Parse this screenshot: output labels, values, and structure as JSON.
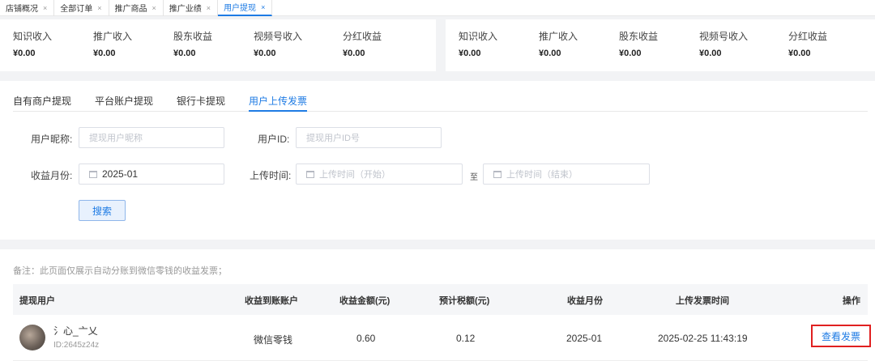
{
  "tabs": [
    {
      "label": "店铺概况",
      "close": "×",
      "active": false
    },
    {
      "label": "全部订单",
      "close": "×",
      "active": false
    },
    {
      "label": "推广商品",
      "close": "×",
      "active": false
    },
    {
      "label": "推广业绩",
      "close": "×",
      "active": false
    },
    {
      "label": "用户提现",
      "close": "×",
      "active": true
    }
  ],
  "stats_left": [
    {
      "label": "知识收入",
      "value": "¥0.00"
    },
    {
      "label": "推广收入",
      "value": "¥0.00"
    },
    {
      "label": "股东收益",
      "value": "¥0.00"
    },
    {
      "label": "视频号收入",
      "value": "¥0.00"
    },
    {
      "label": "分红收益",
      "value": "¥0.00"
    }
  ],
  "stats_right": [
    {
      "label": "知识收入",
      "value": "¥0.00"
    },
    {
      "label": "推广收入",
      "value": "¥0.00"
    },
    {
      "label": "股东收益",
      "value": "¥0.00"
    },
    {
      "label": "视频号收入",
      "value": "¥0.00"
    },
    {
      "label": "分红收益",
      "value": "¥0.00"
    }
  ],
  "subtabs": [
    {
      "label": "自有商户提现",
      "active": false
    },
    {
      "label": "平台账户提现",
      "active": false
    },
    {
      "label": "银行卡提现",
      "active": false
    },
    {
      "label": "用户上传发票",
      "active": true
    }
  ],
  "form": {
    "nickname_label": "用户昵称:",
    "nickname_placeholder": "提现用户昵称",
    "userid_label": "用户ID:",
    "userid_placeholder": "提现用户ID号",
    "month_label": "收益月份:",
    "month_value": "2025-01",
    "upload_time_label": "上传时间:",
    "start_placeholder": "上传时间（开始）",
    "to_label": "至",
    "end_placeholder": "上传时间（结束）",
    "search_label": "搜索"
  },
  "note": "备注：此页面仅展示自动分账到微信零钱的收益发票；",
  "table": {
    "headers": [
      "提现用户",
      "收益到账账户",
      "收益金额(元)",
      "预计税额(元)",
      "收益月份",
      "上传发票时间",
      "操作"
    ],
    "rows": [
      {
        "user_name": "氵心_亠乂",
        "user_id": "ID:2645z24z",
        "account": "微信零钱",
        "amount": "0.60",
        "tax": "0.12",
        "month": "2025-01",
        "upload_time": "2025-02-25 11:43:19",
        "action": "查看发票"
      }
    ]
  },
  "colors": {
    "accent": "#1e7be4",
    "highlight_border": "#e02020"
  }
}
